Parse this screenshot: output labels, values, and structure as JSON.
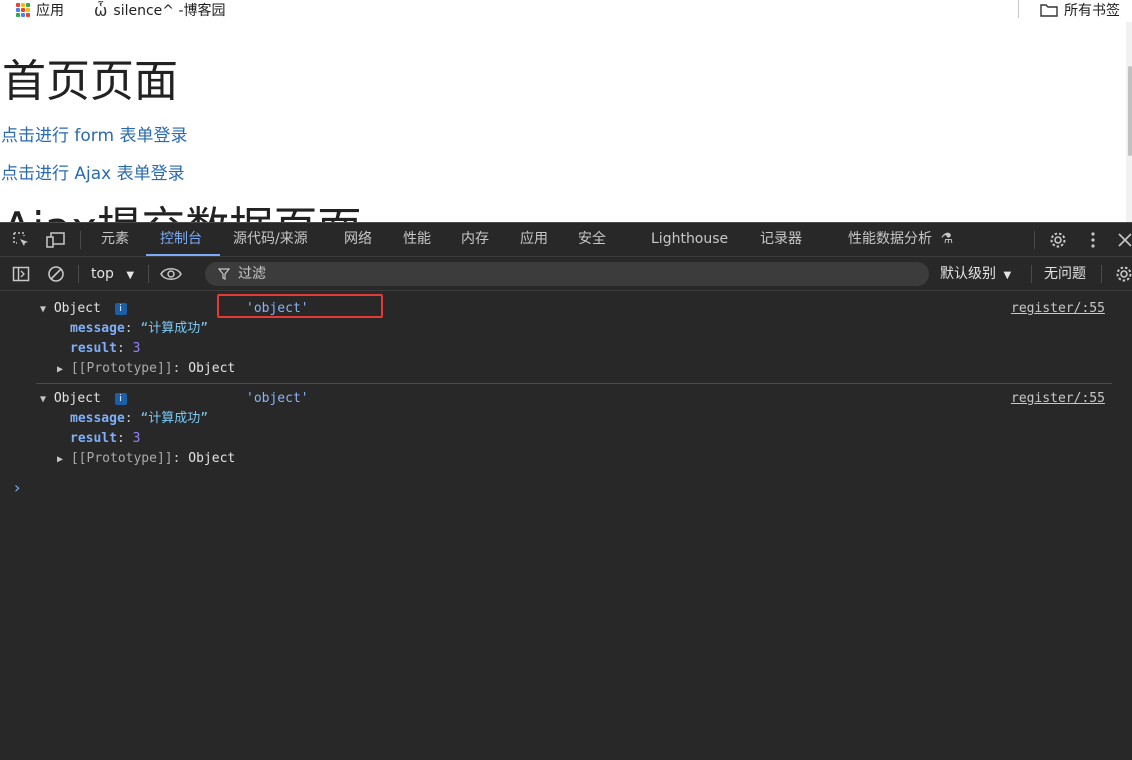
{
  "bookmarks": {
    "apps_label": "应用",
    "site_label": "silence^ -博客园",
    "all_bookmarks_label": "所有书签"
  },
  "page": {
    "heading": "首页页面",
    "link_form": "点击进行 form 表单登录",
    "link_ajax": "点击进行 Ajax 表单登录",
    "heading2_partial": "Ajax提交数据页面"
  },
  "devtools": {
    "tabs": [
      {
        "label": "元素"
      },
      {
        "label": "控制台"
      },
      {
        "label": "源代码/来源"
      },
      {
        "label": "网络"
      },
      {
        "label": "性能"
      },
      {
        "label": "内存"
      },
      {
        "label": "应用"
      },
      {
        "label": "安全"
      },
      {
        "label": "Lighthouse"
      },
      {
        "label": "记录器"
      },
      {
        "label": "性能数据分析"
      }
    ],
    "active_tab": "控制台",
    "toolbar": {
      "context": "top",
      "filter_placeholder": "过滤",
      "level": "默认级别",
      "issues": "无问题"
    },
    "console": {
      "entries": [
        {
          "type_label": "Object",
          "info": "i",
          "typeof_value": "'object'",
          "source": "register/:55",
          "props": [
            {
              "key": "message",
              "value": "“计算成功”"
            },
            {
              "key": "result",
              "value": "3"
            }
          ],
          "prototype_label": "[[Prototype]]",
          "prototype_value": "Object"
        },
        {
          "type_label": "Object",
          "info": "i",
          "typeof_value": "'object'",
          "source": "register/:55",
          "props": [
            {
              "key": "message",
              "value": "“计算成功”"
            },
            {
              "key": "result",
              "value": "3"
            }
          ],
          "prototype_label": "[[Prototype]]",
          "prototype_value": "Object"
        }
      ],
      "prompt": "›"
    }
  },
  "colors": {
    "devtools_bg": "#282828",
    "accent": "#7cacf8",
    "highlight_box": "#e53935",
    "link": "#2a6ab0"
  }
}
